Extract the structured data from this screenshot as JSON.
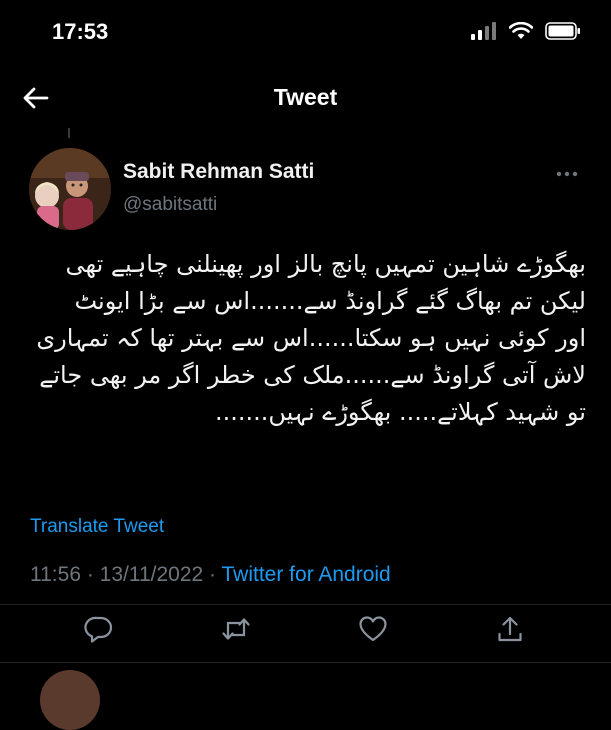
{
  "status_bar": {
    "time": "17:53"
  },
  "header": {
    "title": "Tweet"
  },
  "author": {
    "name": "Sabit Rehman Satti",
    "handle": "@sabitsatti"
  },
  "tweet": {
    "text": "بھگوڑے شاہین تمہیں پانچ بالز اور پھینلنی چاہیے تھی\nلیکن تم بھاگ گئے گراونڈ سے.......اس سے بڑا ایونٹ\nاور کوئی نہیں ہو سکتا......اس سے بہتر تھا کہ تمہاری\nلاش آتی گراونڈ سے......ملک کی خطر اگر مر بھی جاتے\nتو شہید کہلاتے.....  بھگوڑے نہیں.......",
    "translate_label": "Translate Tweet",
    "timestamp": "11:56 · 13/11/2022 ·",
    "source": "Twitter for Android"
  },
  "actions": {
    "reply": "reply-icon",
    "retweet": "retweet-icon",
    "like": "heart-icon",
    "share": "share-icon"
  },
  "colors": {
    "accent": "#1d9bf0",
    "background": "#000000",
    "muted": "#6e767d"
  }
}
